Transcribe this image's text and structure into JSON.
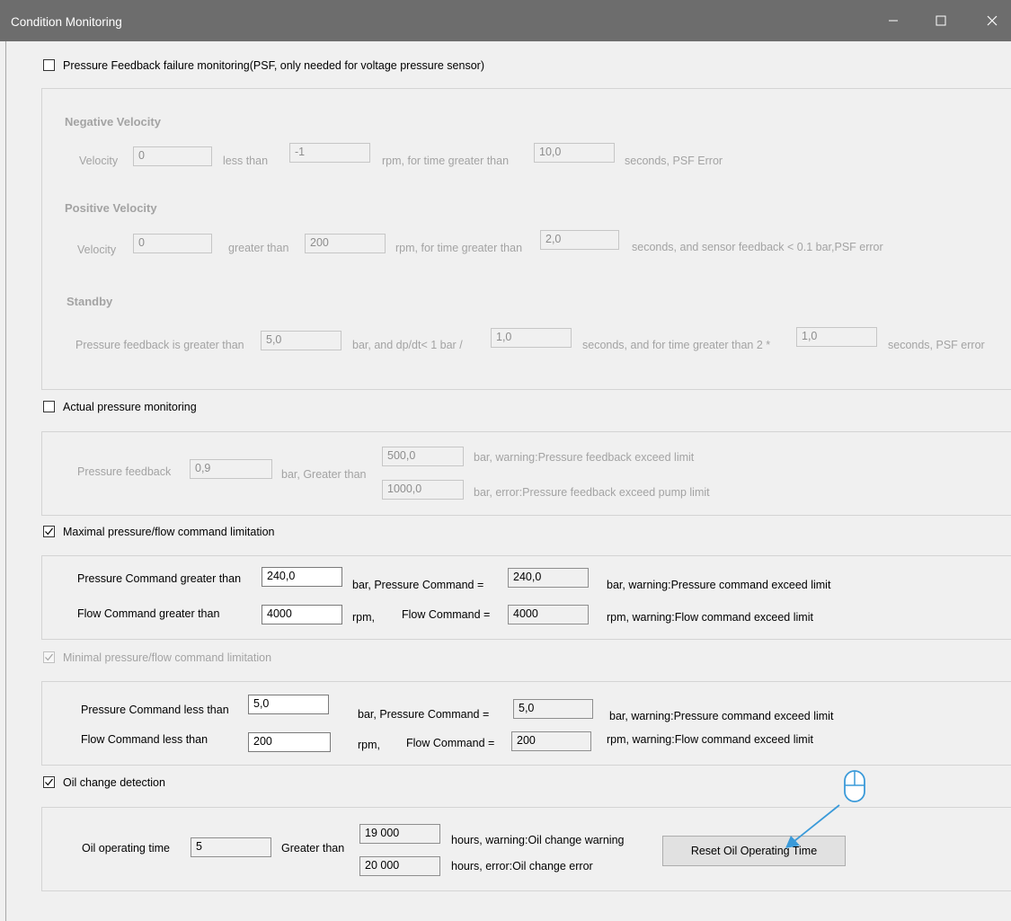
{
  "window": {
    "title": "Condition Monitoring",
    "controls": {
      "minimize": "minimize-icon",
      "maximize": "maximize-icon",
      "close": "close-icon"
    }
  },
  "psf": {
    "checkbox_label": "Pressure Feedback failure monitoring(PSF, only needed for voltage pressure sensor)",
    "checked": false,
    "negative": {
      "heading": "Negative Velocity",
      "velocity_label": "Velocity",
      "velocity_value": "0",
      "cmp_label": "less than",
      "cmp_value": "-1",
      "time_label": "rpm, for time greater than",
      "time_value": "10,0",
      "suffix": "seconds, PSF Error"
    },
    "positive": {
      "heading": "Positive Velocity",
      "velocity_label": "Velocity",
      "velocity_value": "0",
      "cmp_label": "greater than",
      "cmp_value": "200",
      "time_label": "rpm, for time greater than",
      "time_value": "2,0",
      "suffix": "seconds, and sensor feedback < 0.1 bar,PSF error"
    },
    "standby": {
      "heading": "Standby",
      "pf_label": "Pressure feedback is greater than",
      "pf_value": "5,0",
      "dp_label": "bar, and dp/dt< 1 bar /",
      "dp_value": "1,0",
      "time_label": "seconds, and for time greater than 2 *",
      "time_value": "1,0",
      "suffix": "seconds, PSF error"
    }
  },
  "actual": {
    "checkbox_label": "Actual pressure monitoring",
    "checked": false,
    "pf_label": "Pressure feedback",
    "pf_value": "0,9",
    "gt_label": "bar, Greater than",
    "warn_value": "500,0",
    "warn_label": "bar,  warning:Pressure feedback exceed limit",
    "err_value": "1000,0",
    "err_label": "bar,  error:Pressure feedback exceed pump limit"
  },
  "maxlimit": {
    "checkbox_label": "Maximal pressure/flow command limitation",
    "checked": true,
    "p_label": "Pressure Command greater than",
    "p_value": "240,0",
    "p_mid": "bar,  Pressure Command =",
    "p_cmd": "240,0",
    "p_suffix": "bar,  warning:Pressure command exceed  limit",
    "f_label": "Flow Command greater than",
    "f_value": "4000",
    "f_unit": "rpm,",
    "f_mid": "Flow Command =",
    "f_cmd": "4000",
    "f_suffix": "rpm,  warning:Flow command exceed  limit"
  },
  "minlimit": {
    "checkbox_label": "Minimal pressure/flow command limitation",
    "checked": true,
    "p_label": "Pressure Command less than",
    "p_value": "5,0",
    "p_mid": "bar,  Pressure Command =",
    "p_cmd": "5,0",
    "p_suffix": "bar,  warning:Pressure command exceed  limit",
    "f_label": "Flow Command less than",
    "f_value": "200",
    "f_unit": "rpm,",
    "f_mid": "Flow Command =",
    "f_cmd": "200",
    "f_suffix": "rpm,  warning:Flow command exceed  limit"
  },
  "oil": {
    "checkbox_label": "Oil change detection",
    "checked": true,
    "time_label": "Oil operating time",
    "time_value": "5",
    "gt_label": "Greater than",
    "warn_value": "19 000",
    "warn_label": "hours,  warning:Oil change warning",
    "err_value": "20 000",
    "err_label": "hours,  error:Oil change error",
    "reset_button": "Reset Oil Operating Time"
  },
  "colors": {
    "titlebar": "#6d6d6d",
    "annotation": "#3a9ad9",
    "disabled_text": "#a3a3a3"
  }
}
